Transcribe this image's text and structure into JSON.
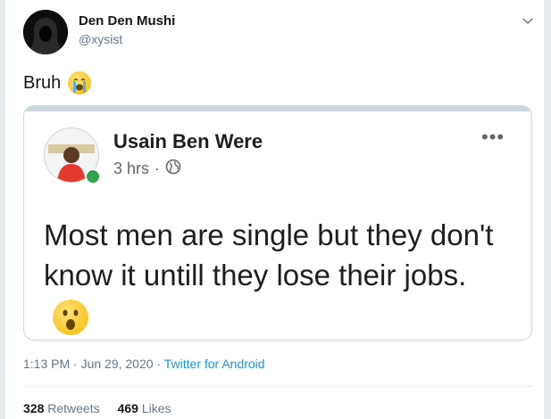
{
  "tweet": {
    "author_name": "Den Den Mushi",
    "author_handle": "@xysist",
    "text": "Bruh",
    "text_emoji": "loudly-crying-face",
    "timestamp": "1:13 PM · Jun 29, 2020",
    "separator": " · ",
    "source": "Twitter for Android",
    "retweets_count": "328",
    "retweets_label": "Retweets",
    "likes_count": "469",
    "likes_label": "Likes"
  },
  "embedded_post": {
    "author_name": "Usain Ben Were",
    "time": "3 hrs",
    "dot": "·",
    "audience_icon": "globe-icon",
    "more_label": "•••",
    "text": "Most men are single but they don't know it untill they lose their jobs.",
    "text_emoji": "face-with-open-mouth"
  },
  "colors": {
    "link": "#1b95e0",
    "secondary_text": "#657786",
    "online": "#31a24c"
  }
}
